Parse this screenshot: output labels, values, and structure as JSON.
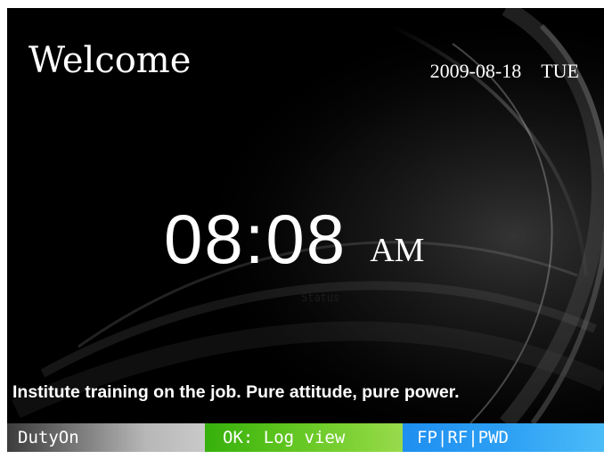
{
  "header": {
    "greeting": "Welcome",
    "date": "2009-08-18",
    "weekday": "TUE"
  },
  "clock": {
    "time": "08:08",
    "meridiem": "AM"
  },
  "status_label": "Status",
  "marquee": "Institute training on the job.  Pure attitude, pure power.",
  "softkeys": {
    "left": "DutyOn",
    "middle": "OK: Log view",
    "right": "FP|RF|PWD"
  },
  "colors": {
    "background": "#000000",
    "text": "#ffffff",
    "softkey_left": "#9a9a9a",
    "softkey_middle": "#5ec41e",
    "softkey_right": "#2c9ff4"
  }
}
